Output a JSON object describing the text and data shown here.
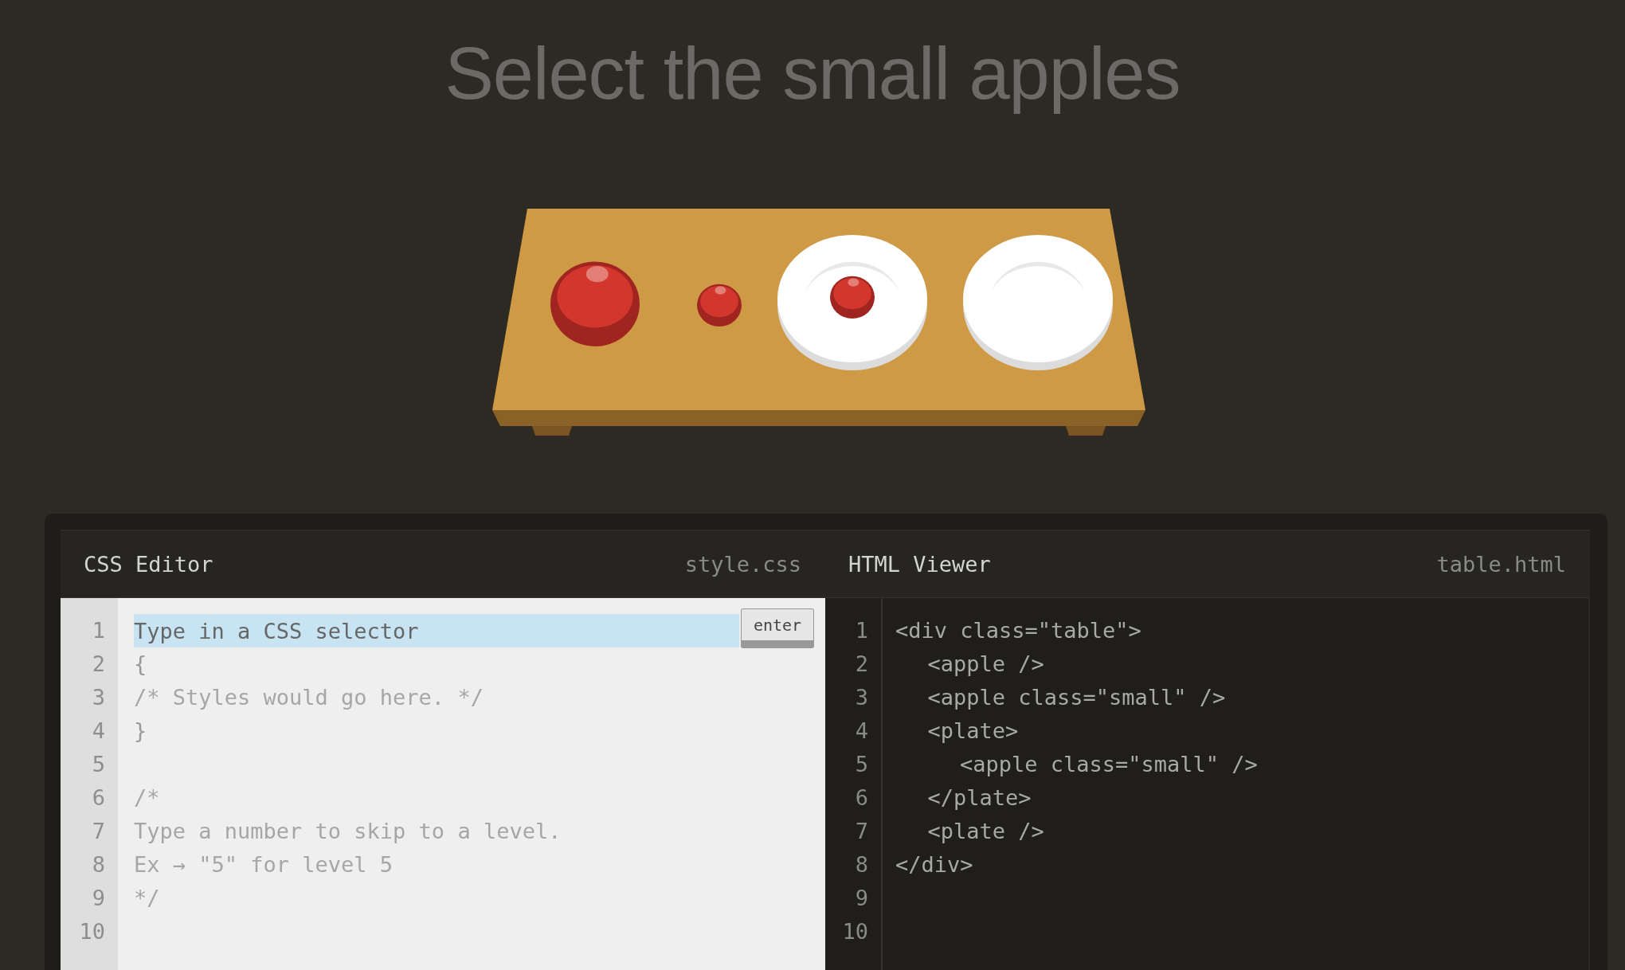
{
  "title": "Select the small apples",
  "table": {
    "items": [
      {
        "kind": "apple"
      },
      {
        "kind": "small-apple"
      },
      {
        "kind": "plate",
        "children": [
          {
            "kind": "small-apple"
          }
        ]
      },
      {
        "kind": "plate"
      }
    ]
  },
  "css_editor": {
    "title": "CSS Editor",
    "filename": "style.css",
    "line_numbers": [
      "1",
      "2",
      "3",
      "4",
      "5",
      "6",
      "7",
      "8",
      "9",
      "10"
    ],
    "input": {
      "placeholder": "Type in a CSS selector",
      "button": "enter"
    },
    "lines": [
      {
        "kind": "code",
        "text": "{"
      },
      {
        "kind": "comment",
        "text": "/* Styles would go here. */"
      },
      {
        "kind": "code",
        "text": "}"
      },
      {
        "kind": "blank"
      },
      {
        "kind": "comment",
        "text": "/*"
      },
      {
        "kind": "comment",
        "text": "Type a number to skip to a level."
      },
      {
        "kind": "comment",
        "text": "Ex → \"5\" for level 5"
      },
      {
        "kind": "comment",
        "text": "*/"
      }
    ]
  },
  "html_viewer": {
    "title": "HTML Viewer",
    "filename": "table.html",
    "line_numbers": [
      "1",
      "2",
      "3",
      "4",
      "5",
      "6",
      "7",
      "8",
      "9",
      "10"
    ],
    "markup": [
      {
        "open": "<div class=\"table\">",
        "close": "</div>",
        "children": [
          {
            "open": "<apple />"
          },
          {
            "open": "<apple class=\"small\" />"
          },
          {
            "open": "<plate>",
            "close": "</plate>",
            "children": [
              {
                "open": "<apple class=\"small\" />"
              }
            ]
          },
          {
            "open": "<plate />"
          }
        ]
      }
    ]
  }
}
